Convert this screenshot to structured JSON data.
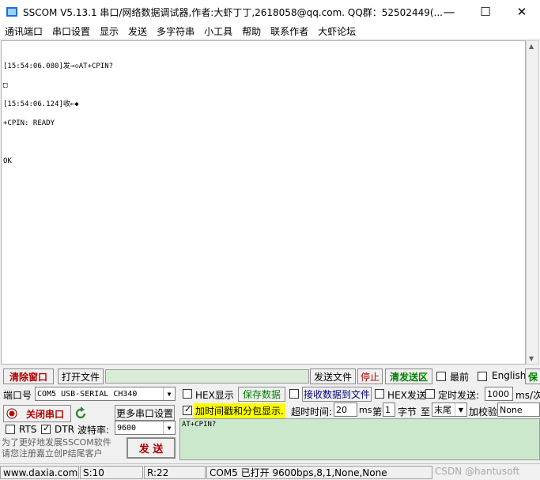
{
  "title": "SSCOM V5.13.1 串口/网络数据调试器,作者:大虾丁丁,2618058@qq.com. QQ群：52502449(...",
  "menu": [
    "通讯端口",
    "串口设置",
    "显示",
    "发送",
    "多字符串",
    "小工具",
    "帮助",
    "联系作者",
    "大虾论坛"
  ],
  "window_buttons": {
    "minimize": "—",
    "maximize": "☐",
    "close": "✕"
  },
  "log_lines": [
    "[15:54:06.080]发→◇AT+CPIN?",
    "□",
    "[15:54:06.124]收←◆",
    "+CPIN: READY",
    "",
    "OK"
  ],
  "toolbar": {
    "clear_window": "清除窗口",
    "open_file": "打开文件",
    "send_file": "发送文件",
    "stop": "停止",
    "clear_send": "清发送区",
    "topmost": "最前",
    "english": "English",
    "save_cut": "保"
  },
  "port": {
    "label": "端口号",
    "value": "COM5 USB-SERIAL CH340",
    "close_port": "关闭串口",
    "more_settings": "更多串口设置",
    "rts": "RTS",
    "dtr": "DTR",
    "baud_label": "波特率:",
    "baud_value": "9600"
  },
  "options": {
    "hex_display": "HEX显示",
    "save_data": "保存数据",
    "recv_to_file": "接收数据到文件",
    "hex_send": "HEX发送",
    "timed_send": "定时发送:",
    "interval_value": "1000",
    "interval_unit": "ms/次",
    "timestamp": "加时间戳和分包显示.",
    "timeout_label": "超时时间:",
    "timeout_value": "20",
    "timeout_unit": "ms",
    "nth_label": "第",
    "nth_value": "1",
    "byte_label": "字节",
    "to_label": "至",
    "end_value": "末尾",
    "checksum_label": "加校验",
    "checksum_value": "None"
  },
  "promo": "为了更好地发展SSCOM软件\n请您注册嘉立创P结尾客户",
  "send_button": "发 送",
  "send_text": "AT+CPIN?",
  "status": {
    "site": "www.daxia.com",
    "sent": "S:10",
    "recv": "R:22",
    "port_info": "COM5 已打开  9600bps,8,1,None,None"
  },
  "watermark": "CSDN @hantusoft",
  "colors": {
    "highlight": "#ffff00",
    "send_area": "#cce8cc",
    "red_text": "#b00000",
    "green_text": "#008000"
  }
}
